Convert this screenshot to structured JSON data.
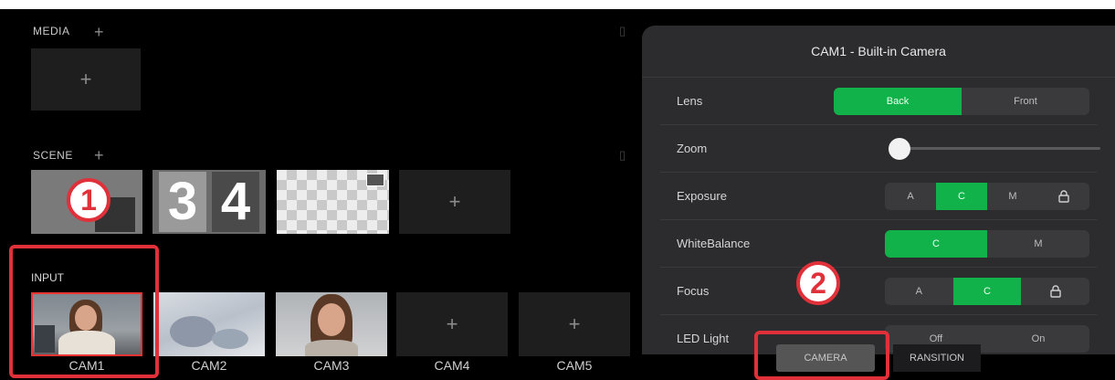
{
  "media": {
    "label": "MEDIA",
    "add_icon": "+",
    "tile_plus": "+"
  },
  "scene": {
    "label": "SCENE",
    "add_icon": "+",
    "thumb2_digits": [
      "3",
      "4"
    ],
    "tile_plus": "+"
  },
  "input": {
    "label": "INPUT",
    "cameras": [
      {
        "name": "CAM1"
      },
      {
        "name": "CAM2"
      },
      {
        "name": "CAM3"
      },
      {
        "name": "CAM4",
        "plus": "+"
      },
      {
        "name": "CAM5",
        "plus": "+"
      }
    ]
  },
  "callouts": {
    "one": "1",
    "two": "2"
  },
  "panel": {
    "title": "CAM1 - Built-in Camera",
    "lens": {
      "label": "Lens",
      "options": [
        "Back",
        "Front"
      ],
      "selected": "Back"
    },
    "zoom": {
      "label": "Zoom",
      "value": 0
    },
    "exposure": {
      "label": "Exposure",
      "options": [
        "A",
        "C",
        "M"
      ],
      "selected": "C",
      "lock_icon": "lock-icon"
    },
    "white_balance": {
      "label": "WhiteBalance",
      "options": [
        "C",
        "M"
      ],
      "selected": "C"
    },
    "focus": {
      "label": "Focus",
      "options": [
        "A",
        "C"
      ],
      "selected": "C",
      "lock_icon": "lock-icon"
    },
    "led_light": {
      "label": "LED Light",
      "options": [
        "Off",
        "On"
      ]
    }
  },
  "tabs": {
    "camera": "CAMERA",
    "transition": "RANSITION"
  },
  "colors": {
    "accent_green": "#12b24a",
    "highlight_red": "#e0303a",
    "selected_border": "#e33"
  }
}
